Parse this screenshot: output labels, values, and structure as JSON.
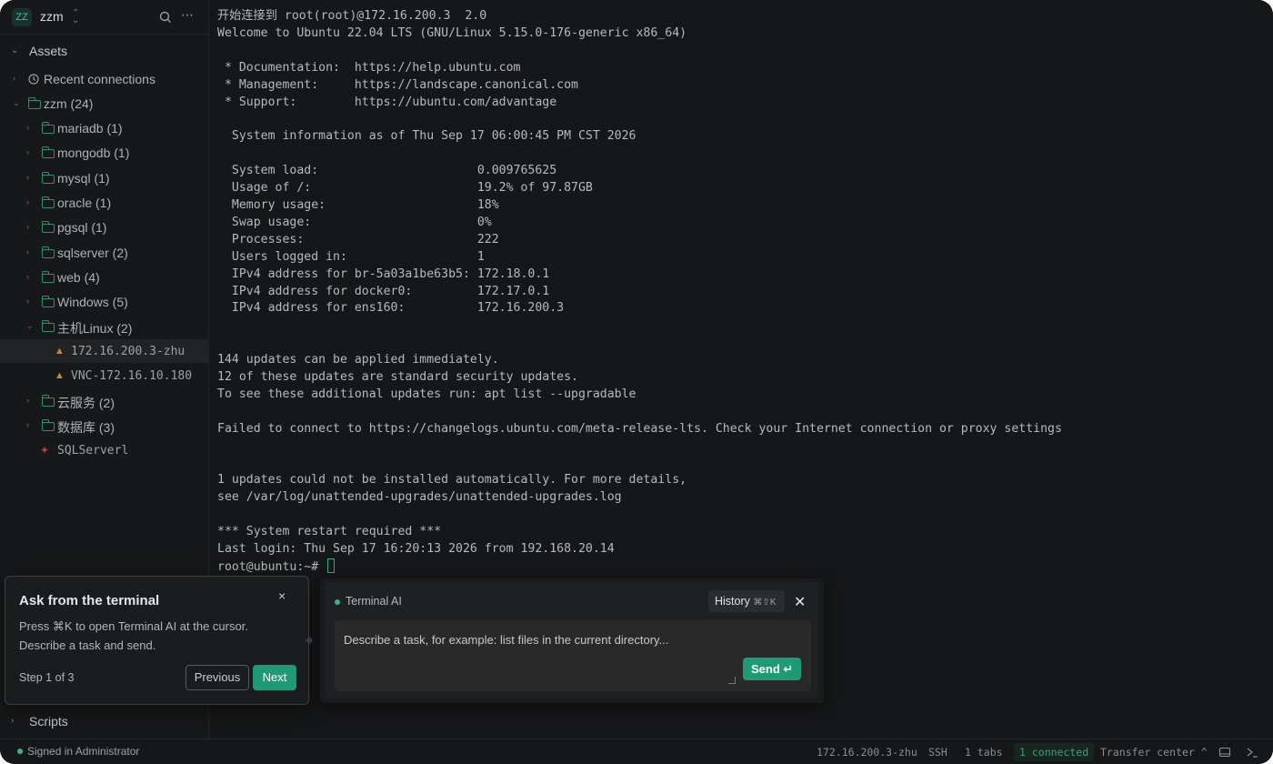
{
  "workspace": {
    "avatar": "ZZ",
    "name": "zzm"
  },
  "sections": {
    "assets": "Assets",
    "scripts": "Scripts"
  },
  "tree": {
    "recent": "Recent connections",
    "root": "zzm (24)",
    "folders": [
      "mariadb (1)",
      "mongodb (1)",
      "mysql (1)",
      "oracle (1)",
      "pgsql (1)",
      "sqlserver (2)",
      "web (4)",
      "Windows (5)"
    ],
    "linux_folder": "主机Linux (2)",
    "linux_hosts": [
      "172.16.200.3-zhu",
      "VNC-172.16.10.180"
    ],
    "more_folders": [
      "云服务 (2)",
      "数据库 (3)"
    ],
    "sqlserver_item": "SQLServerl"
  },
  "terminal": {
    "lines": [
      "开始连接到 root(root)@172.16.200.3  2.0",
      "Welcome to Ubuntu 22.04 LTS (GNU/Linux 5.15.0-176-generic x86_64)",
      "",
      " * Documentation:  https://help.ubuntu.com",
      " * Management:     https://landscape.canonical.com",
      " * Support:        https://ubuntu.com/advantage",
      "",
      "  System information as of Thu Sep 17 06:00:45 PM CST 2026",
      "",
      "  System load:                      0.009765625",
      "  Usage of /:                       19.2% of 97.87GB",
      "  Memory usage:                     18%",
      "  Swap usage:                       0%",
      "  Processes:                        222",
      "  Users logged in:                  1",
      "  IPv4 address for br-5a03a1be63b5: 172.18.0.1",
      "  IPv4 address for docker0:         172.17.0.1",
      "  IPv4 address for ens160:          172.16.200.3",
      "",
      "",
      "144 updates can be applied immediately.",
      "12 of these updates are standard security updates.",
      "To see these additional updates run: apt list --upgradable",
      "",
      "Failed to connect to https://changelogs.ubuntu.com/meta-release-lts. Check your Internet connection or proxy settings",
      "",
      "",
      "1 updates could not be installed automatically. For more details,",
      "see /var/log/unattended-upgrades/unattended-upgrades.log",
      "",
      "*** System restart required ***",
      "Last login: Thu Sep 17 16:20:13 2026 from 192.168.20.14"
    ],
    "prompt": "root@ubuntu:~#"
  },
  "tour": {
    "title": "Ask from the terminal",
    "body_line1": "Press ⌘K to open Terminal AI at the cursor.",
    "body_line2": "Describe a task and send.",
    "step": "Step 1 of 3",
    "previous": "Previous",
    "next": "Next",
    "close": "×"
  },
  "ai": {
    "title": "Terminal AI",
    "history": "History",
    "history_shortcut": "⌘⇧K",
    "close": "✕",
    "placeholder": "Describe a task, for example: list files in the current directory...",
    "send": "Send",
    "send_key": "↵"
  },
  "status": {
    "signed_in": "Signed in Administrator",
    "host": "172.16.200.3-zhu",
    "protocol": "SSH",
    "tabs": "1 tabs",
    "connected": "1 connected",
    "transfer": "Transfer center",
    "transfer_icon": "^"
  },
  "colors": {
    "accent": "#1e9a74",
    "background": "#161718",
    "folder": "#2e8f6f"
  }
}
